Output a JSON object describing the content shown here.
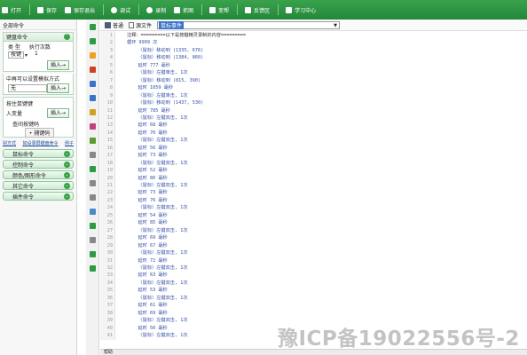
{
  "toolbar": {
    "items": [
      {
        "label": "打开",
        "icon": "open-icon",
        "color": "#f4f4f4"
      },
      {
        "label": "保存",
        "icon": "save-icon",
        "color": "#ffffff"
      },
      {
        "label": "保存退出",
        "icon": "save-exit-icon",
        "color": "#ffffff"
      },
      {
        "label": "调试",
        "icon": "debug-icon",
        "color": "#ffffff"
      },
      {
        "label": "录制",
        "icon": "record-icon",
        "color": "#ffffff"
      },
      {
        "label": "抓图",
        "icon": "capture-icon",
        "color": "#ffffff"
      },
      {
        "label": "变帮",
        "icon": "gear-icon",
        "color": "#ffffff"
      },
      {
        "label": "反馈区",
        "icon": "feedback-icon",
        "color": "#ffffff"
      },
      {
        "label": "学习中心",
        "icon": "learn-icon",
        "color": "#ffffff"
      }
    ]
  },
  "left": {
    "title": "全部命令",
    "keyboard": {
      "header": "键盘命令",
      "type_label": "类 型",
      "times_label": "执行次数",
      "type_value": "按键",
      "times_value": "1",
      "insert": "插入→"
    },
    "key_panel": {
      "header": "中再可以设置模拟方式",
      "key_value": "无",
      "insert": "插入→"
    },
    "seq_panel": {
      "header": "按住鼠键键",
      "set_label": "入变量",
      "insert": "插入→",
      "record_label": "查间按键码",
      "record_btn": "捕键码"
    },
    "links": [
      "别方式",
      "如设录屏键盘命令",
      "例子"
    ],
    "buttons": [
      "鼠标命令",
      "控制命令",
      "颜色/图形命令",
      "其它命令",
      "插件命令"
    ]
  },
  "editor": {
    "top_btn": "普通",
    "top_btn2": "源文件",
    "dropdown_value": "鼠标事件",
    "lines": [
      "注释：=========以下是按键精灵录制的内容=========",
      "循环 9999 次",
      "    〈鼠标〉移动到 (1335, 676)",
      "    〈鼠标〉移动到 (1384, 860)",
      "    延时 777 毫秒",
      "    〈鼠标〉左键单击, 1次",
      "    〈鼠标〉移动到 (815, 390)",
      "    延时 1059 毫秒",
      "    〈鼠标〉左键单击, 1次",
      "    〈鼠标〉移动到 (1437, 530)",
      "    延时 785 毫秒",
      "    〈鼠标〉左键双击, 1次",
      "    延时 68 毫秒",
      "    延时 70 毫秒",
      "    〈鼠标〉左键双击, 1次",
      "    延时 56 毫秒",
      "    延时 73 毫秒",
      "    〈鼠标〉左键双击, 1次",
      "    延时 52 毫秒",
      "    延时 80 毫秒",
      "    〈鼠标〉左键双击, 1次",
      "    延时 73 毫秒",
      "    延时 76 毫秒",
      "    〈鼠标〉左键双击, 1次",
      "    延时 54 毫秒",
      "    延时 85 毫秒",
      "    〈鼠标〉左键双击, 1次",
      "    延时 69 毫秒",
      "    延时 67 毫秒",
      "    〈鼠标〉左键双击, 1次",
      "    延时 72 毫秒",
      "    〈鼠标〉左键双击, 1次",
      "    延时 63 毫秒",
      "    〈鼠标〉左键双击, 1次",
      "    延时 53 毫秒",
      "    〈鼠标〉左键双击, 1次",
      "    延时 61 毫秒",
      "    延时 69 毫秒",
      "    〈鼠标〉左键双击, 1次",
      "    延时 50 毫秒",
      "    〈鼠标〉左键双击, 1次"
    ]
  },
  "status": "帮助",
  "watermark": "豫ICP备19022556号-2",
  "colors": {
    "accent": "#2e9a43",
    "code": "#3350a8"
  }
}
